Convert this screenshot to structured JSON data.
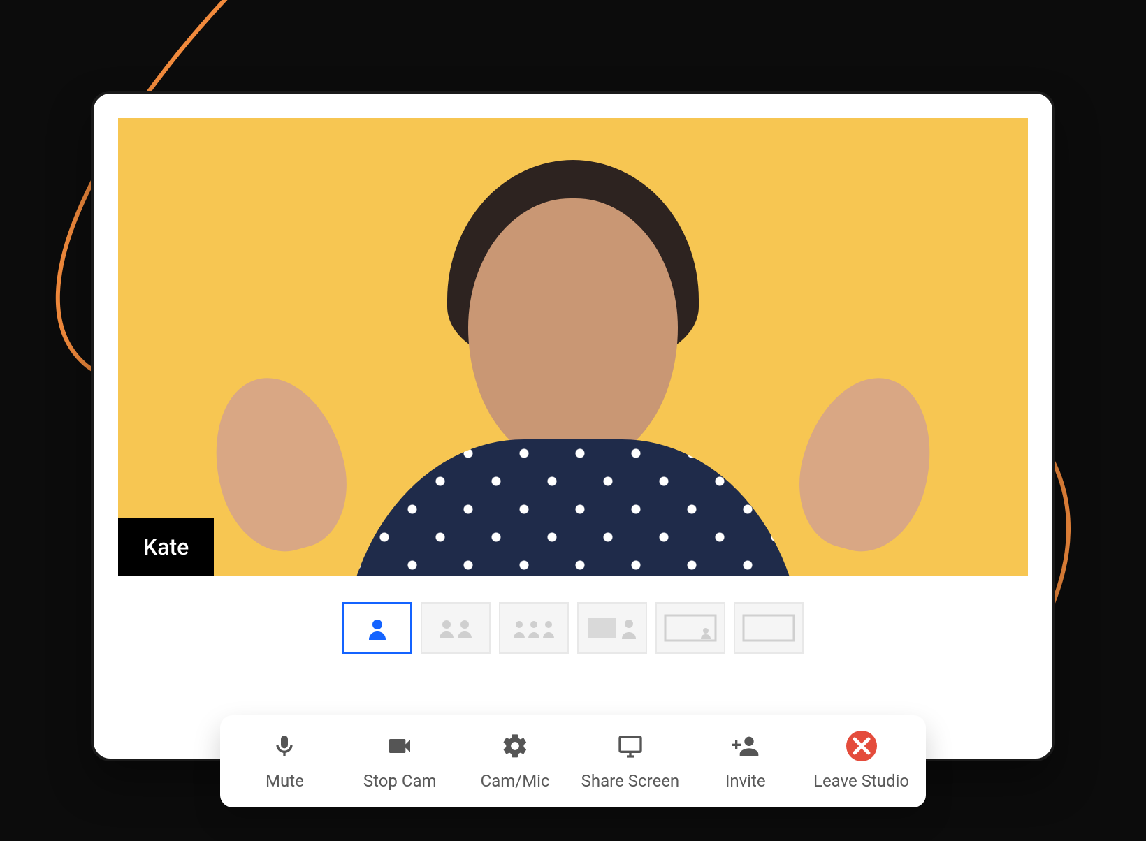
{
  "participant": {
    "name": "Kate"
  },
  "layouts": {
    "selected_index": 0,
    "options": [
      {
        "id": "single"
      },
      {
        "id": "two-up"
      },
      {
        "id": "three-up"
      },
      {
        "id": "screen-with-speaker"
      },
      {
        "id": "screen-with-thumb"
      },
      {
        "id": "screen-only"
      }
    ]
  },
  "toolbar": {
    "items": [
      {
        "id": "mute",
        "label": "Mute",
        "icon": "mic-icon"
      },
      {
        "id": "stop-cam",
        "label": "Stop Cam",
        "icon": "camera-icon"
      },
      {
        "id": "cam-mic",
        "label": "Cam/Mic",
        "icon": "gear-icon"
      },
      {
        "id": "share-screen",
        "label": "Share Screen",
        "icon": "screen-icon"
      },
      {
        "id": "invite",
        "label": "Invite",
        "icon": "add-user-icon"
      },
      {
        "id": "leave",
        "label": "Leave Studio",
        "icon": "close-circle-icon"
      }
    ]
  },
  "colors": {
    "accent": "#1463ff",
    "video_bg": "#f7c652",
    "danger": "#e44c3c",
    "swirl": "#f18a3c"
  }
}
